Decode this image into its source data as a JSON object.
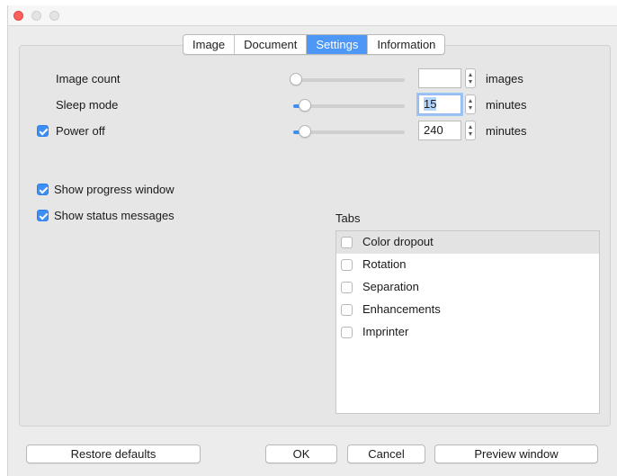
{
  "tabs": [
    {
      "label": "Image",
      "active": false
    },
    {
      "label": "Document",
      "active": false
    },
    {
      "label": "Settings",
      "active": true
    },
    {
      "label": "Information",
      "active": false
    }
  ],
  "settings": {
    "image_count": {
      "label": "Image count",
      "value": "",
      "unit": "images",
      "slider_fraction": 0.0
    },
    "sleep_mode": {
      "label": "Sleep mode",
      "value": "15",
      "unit": "minutes",
      "slider_fraction": 0.08,
      "focused": true
    },
    "power_off": {
      "label": "Power off",
      "checked": true,
      "value": "240",
      "unit": "minutes",
      "slider_fraction": 0.08
    }
  },
  "options": {
    "show_progress_window": {
      "label": "Show progress window",
      "checked": true
    },
    "show_status_messages": {
      "label": "Show status messages",
      "checked": true
    }
  },
  "tabs_list": {
    "title": "Tabs",
    "items": [
      {
        "label": "Color dropout",
        "checked": false,
        "selected": true
      },
      {
        "label": "Rotation",
        "checked": false,
        "selected": false
      },
      {
        "label": "Separation",
        "checked": false,
        "selected": false
      },
      {
        "label": "Enhancements",
        "checked": false,
        "selected": false
      },
      {
        "label": "Imprinter",
        "checked": false,
        "selected": false
      }
    ]
  },
  "buttons": {
    "restore_defaults": "Restore defaults",
    "ok": "OK",
    "cancel": "Cancel",
    "preview_window": "Preview window"
  },
  "colors": {
    "accent": "#3e8ff5",
    "close_button": "#fc605c",
    "window_bg": "#ececec"
  }
}
